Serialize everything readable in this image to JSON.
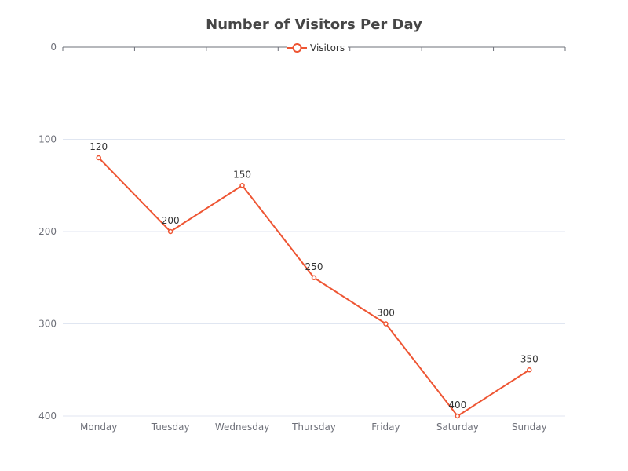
{
  "chart_data": {
    "type": "line",
    "title": "Number of Visitors Per Day",
    "xlabel": "",
    "ylabel": "",
    "categories": [
      "Monday",
      "Tuesday",
      "Wednesday",
      "Thursday",
      "Friday",
      "Saturday",
      "Sunday"
    ],
    "series": [
      {
        "name": "Visitors",
        "values": [
          120,
          200,
          150,
          250,
          300,
          400,
          350
        ],
        "color": "#ee5533"
      }
    ],
    "yticks": [
      0,
      100,
      200,
      300,
      400
    ],
    "ylim": [
      0,
      400
    ],
    "y_inverted": true,
    "grid": true,
    "legend": "top-center",
    "data_labels": true
  }
}
